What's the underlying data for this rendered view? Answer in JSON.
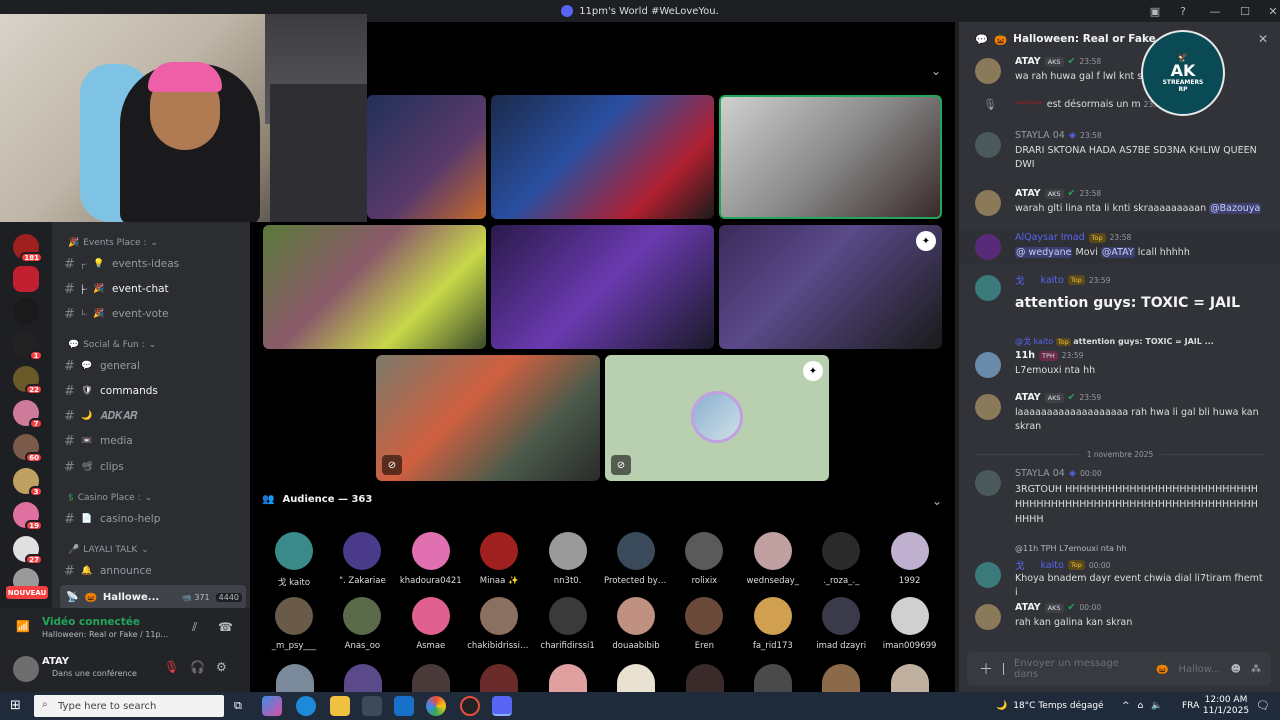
{
  "window": {
    "title": "11pm's World #WeLoveYou."
  },
  "server_badges": [
    "181",
    "1",
    "22",
    "7",
    "60",
    "3",
    "19",
    "27",
    "4"
  ],
  "nouveau_label": "NOUVEAU",
  "channels": {
    "categories": [
      "Events Place :",
      "Social & Fun :",
      "Casino Place :",
      "LAYALI TALK"
    ],
    "items": [
      {
        "emoji": "💡",
        "label": "events-ideas",
        "prefix": "┌·"
      },
      {
        "emoji": "🎉",
        "label": "event-chat",
        "prefix": "├·"
      },
      {
        "emoji": "🎉",
        "label": "event-vote",
        "prefix": "└·"
      },
      {
        "emoji": "💬",
        "label": "general"
      },
      {
        "emoji": "🛡",
        "label": "commands"
      },
      {
        "emoji": "🌙",
        "label": "𝑨𝑫𝑲𝑨𝑹"
      },
      {
        "emoji": "📼",
        "label": "media"
      },
      {
        "emoji": "📽",
        "label": "clips"
      },
      {
        "emoji": "📄",
        "label": "casino-help"
      },
      {
        "emoji": "🔔",
        "label": "announce"
      }
    ],
    "voice": {
      "label": "Hallowe...",
      "video_count": "371",
      "members": "4440"
    }
  },
  "voice_panel": {
    "status": "Vidéo connectée",
    "subtitle": "Halloween: Real or Fake / 11p...",
    "user": "ATAY",
    "state": "Dans une conférence"
  },
  "audience": {
    "label": "Audience — 363",
    "members": [
      "戈 kaito",
      "\". Zakariae",
      "khadoura0421",
      "Minaa ✨",
      "nn3t0.",
      "Protected by !...",
      "rolixix",
      "wednseday_",
      "._roza_._",
      "1992",
      "_m_psy___",
      "Anas_oo",
      "Asmae",
      "chakibidrissi7...",
      "charifidirssi1",
      "douaabibib",
      "Eren",
      "fa_rid173",
      "imad dzayri",
      "iman009699"
    ]
  },
  "chat": {
    "header": "Halloween: Real or Fake",
    "date_separator": "1 novembre 2025",
    "composer_placeholder": "Envoyer un message dans",
    "composer_channel": "Hallow...",
    "messages": [
      {
        "user": "ATAY",
        "tag": "AKS",
        "time": "23:58",
        "text": "wa rah huwa gal f lwl knt skr"
      },
      {
        "user": "",
        "tag": "",
        "time": "23:58",
        "text": "est désormais un m"
      },
      {
        "user": "STAYLA 04",
        "tag": "",
        "time": "23:58",
        "text": "DRARI SKTONA HADA AS7BE SD3NA KHLIW QUEEN DWI"
      },
      {
        "user": "ATAY",
        "tag": "AKS",
        "time": "23:58",
        "text": "warah glti lina nta li knti skraaaaaaaaan",
        "mention": "@Bazouya"
      },
      {
        "user": "AlQaysar Imad",
        "tag": "Top",
        "time": "23:58",
        "text": "Movi",
        "mention_pre": "@ wedyane",
        "mention": "@ATAY",
        "text2": "lcall hhhhh"
      },
      {
        "user": "kaito",
        "tag": "Top",
        "time": "23:59",
        "text": "attention guys: TOXIC = JAIL"
      },
      {
        "user": "11h",
        "tag": "TPH",
        "time": "23:59",
        "text": "L7emouxi nta hh",
        "reply": "attention guys: TOXIC = JAIL ..."
      },
      {
        "user": "ATAY",
        "tag": "AKS",
        "time": "23:59",
        "text": "laaaaaaaaaaaaaaaaaaa rah hwa li gal bli huwa kan skran"
      },
      {
        "user": "STAYLA 04",
        "tag": "",
        "time": "00:00",
        "text": "3RGTOUH HHHHHHHHHHHHHHHHHHHHHHHHHHHHHHHHHHHHHHHHHHHHHHHHHHHHHHHHHHHHHHHHH"
      },
      {
        "user": "kaito",
        "tag": "Top",
        "time": "00:00",
        "text": "Khoya bnadem dayr event chwia dial li7tiram fhemti",
        "reply": "@11h  TPH  L7emouxi nta hh"
      },
      {
        "user": "ATAY",
        "tag": "AKS",
        "time": "00:00",
        "text": "rah kan galina kan skran"
      }
    ]
  },
  "logo": {
    "line1": "AK",
    "line2": "STREAMERS",
    "line3": "RP"
  },
  "taskbar": {
    "search": "Type here to search",
    "weather": "18°C  Temps dégagé",
    "lang": "FRA",
    "time": "12:00 AM",
    "date": "11/1/2025"
  }
}
